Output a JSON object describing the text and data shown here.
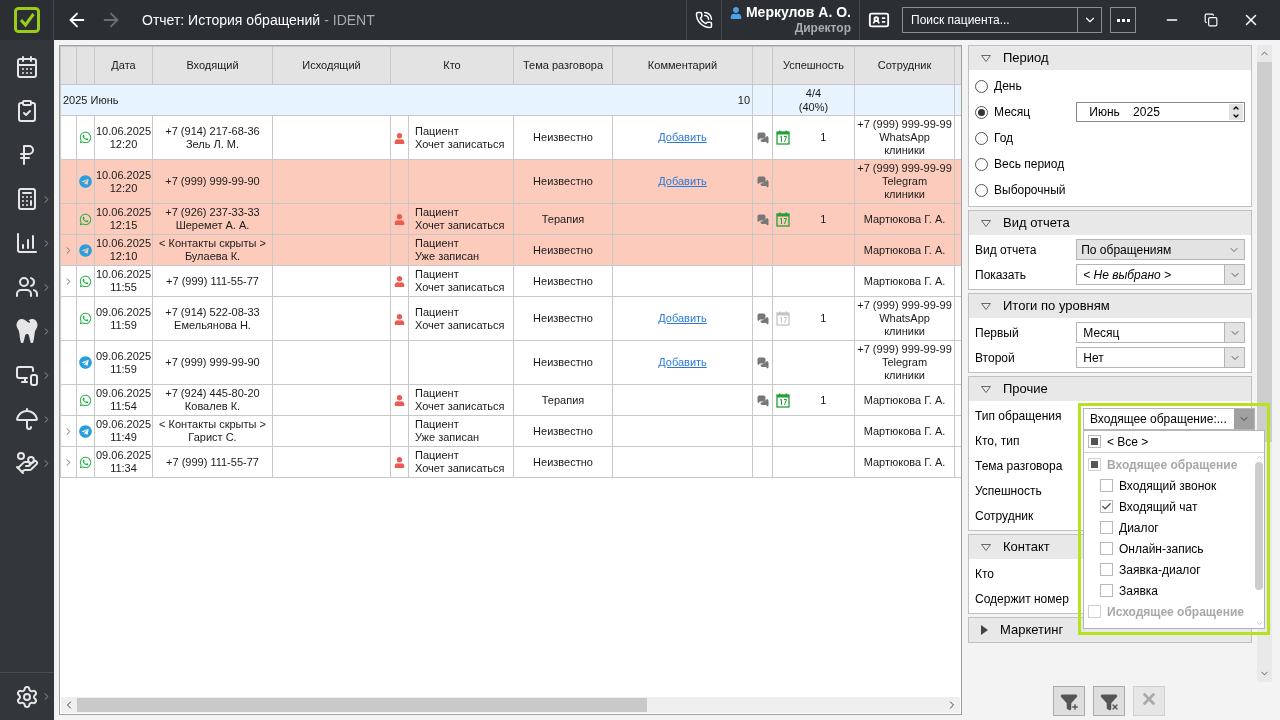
{
  "window": {
    "title": "Отчет: История обращений",
    "app_name": "- IDENT"
  },
  "navigation": {
    "back_enabled": true,
    "forward_enabled": false
  },
  "user": {
    "name": "Меркулов А. О.",
    "role": "Директор"
  },
  "search": {
    "placeholder": "Поиск пациента..."
  },
  "sidebar": {
    "items": [
      {
        "expandable": false
      },
      {
        "expandable": false
      },
      {
        "expandable": false
      },
      {
        "expandable": true
      },
      {
        "expandable": true
      },
      {
        "expandable": true
      },
      {
        "expandable": true
      },
      {
        "expandable": true
      },
      {
        "expandable": true
      },
      {
        "expandable": true
      }
    ],
    "settings": {
      "expandable": true
    }
  },
  "table": {
    "columns": [
      "Дата",
      "Входящий",
      "Исходящий",
      "Кто",
      "Тема разговора",
      "Комментарий",
      "Успешность",
      "Сотрудник"
    ],
    "group": {
      "label": "2025 Июнь",
      "count": "10",
      "success": "4/4",
      "success_percent": "(40%)"
    },
    "rows": [
      {
        "highlighted": false,
        "expandable": false,
        "channel": {
          "kind": "whatsapp"
        },
        "date": "10.06.2025",
        "time": "12:20",
        "incoming": [
          "+7 (914) 217-68-36",
          "Зель Л. М."
        ],
        "who_icon": true,
        "who": [
          "Пациент",
          "Хочет записаться"
        ],
        "topic": "Неизвестно",
        "comment_link": "Добавить",
        "comment_icon": true,
        "calendar": {
          "kind": "active"
        },
        "success_count": "1",
        "employee": [
          "+7 (999) 999-99-99",
          "WhatsApp",
          "клиники"
        ]
      },
      {
        "highlighted": true,
        "expandable": false,
        "channel": {
          "kind": "telegram"
        },
        "date": "10.06.2025",
        "time": "12:20",
        "incoming": [
          "+7 (999) 999-99-90"
        ],
        "who_icon": false,
        "topic": "Неизвестно",
        "comment_link": "Добавить",
        "comment_icon": true,
        "employee": [
          "+7 (999) 999-99-99",
          "Telegram",
          "клиники"
        ]
      },
      {
        "highlighted": true,
        "expandable": false,
        "channel": {
          "kind": "whatsapp"
        },
        "date": "10.06.2025",
        "time": "12:15",
        "incoming": [
          "+7 (926) 237-33-33",
          "Шеремет А. А."
        ],
        "who_icon": true,
        "who": [
          "Пациент",
          "Хочет записаться"
        ],
        "topic": "Терапия",
        "comment_icon": true,
        "calendar": {
          "kind": "active"
        },
        "success_count": "1",
        "employee": [
          "Мартюкова Г. А."
        ]
      },
      {
        "highlighted": true,
        "expandable": true,
        "channel": {
          "kind": "telegram"
        },
        "date": "10.06.2025",
        "time": "12:10",
        "incoming": [
          "< Контакты скрыты >",
          "Булаева К."
        ],
        "who_icon": false,
        "who": [
          "Пациент",
          "Уже записан"
        ],
        "topic": "Неизвестно",
        "comment_icon": false,
        "employee": [
          "Мартюкова Г. А."
        ]
      },
      {
        "highlighted": false,
        "expandable": true,
        "channel": {
          "kind": "whatsapp"
        },
        "date": "10.06.2025",
        "time": "11:55",
        "incoming": [
          "+7 (999) 111-55-77"
        ],
        "who_icon": true,
        "who": [
          "Пациент",
          "Хочет записаться"
        ],
        "topic": "Неизвестно",
        "comment_icon": false,
        "employee": [
          "Мартюкова Г. А."
        ]
      },
      {
        "highlighted": false,
        "expandable": false,
        "channel": {
          "kind": "whatsapp"
        },
        "date": "09.06.2025",
        "time": "11:59",
        "incoming": [
          "+7 (914) 522-08-33",
          "Емельянова Н."
        ],
        "who_icon": true,
        "who": [
          "Пациент",
          "Хочет записаться"
        ],
        "topic": "Неизвестно",
        "comment_link": "Добавить",
        "comment_icon": true,
        "calendar": {
          "kind": "inactive"
        },
        "success_count": "1",
        "employee": [
          "+7 (999) 999-99-99",
          "WhatsApp",
          "клиники"
        ]
      },
      {
        "highlighted": false,
        "expandable": false,
        "channel": {
          "kind": "telegram"
        },
        "date": "09.06.2025",
        "time": "11:59",
        "incoming": [
          "+7 (999) 999-99-90"
        ],
        "who_icon": false,
        "topic": "Неизвестно",
        "comment_link": "Добавить",
        "comment_icon": true,
        "employee": [
          "+7 (999) 999-99-99",
          "Telegram",
          "клиники"
        ]
      },
      {
        "highlighted": false,
        "expandable": false,
        "channel": {
          "kind": "whatsapp"
        },
        "date": "09.06.2025",
        "time": "11:54",
        "incoming": [
          "+7 (924) 445-80-20",
          "Ковалев К."
        ],
        "who_icon": true,
        "who": [
          "Пациент",
          "Хочет записаться"
        ],
        "topic": "Терапия",
        "comment_icon": true,
        "calendar": {
          "kind": "active"
        },
        "success_count": "1",
        "employee": [
          "Мартюкова Г. А."
        ]
      },
      {
        "highlighted": false,
        "expandable": true,
        "channel": {
          "kind": "telegram"
        },
        "date": "09.06.2025",
        "time": "11:49",
        "incoming": [
          "< Контакты скрыты >",
          "Гарист С."
        ],
        "who_icon": false,
        "who": [
          "Пациент",
          "Уже записан"
        ],
        "topic": "Неизвестно",
        "comment_icon": false,
        "employee": [
          "Мартюкова Г. А."
        ]
      },
      {
        "highlighted": false,
        "expandable": true,
        "channel": {
          "kind": "whatsapp"
        },
        "date": "09.06.2025",
        "time": "11:34",
        "incoming": [
          "+7 (999) 111-55-77"
        ],
        "who_icon": true,
        "who": [
          "Пациент",
          "Хочет записаться"
        ],
        "topic": "Неизвестно",
        "comment_icon": false,
        "employee": [
          "Мартюкова Г. А."
        ]
      }
    ]
  },
  "filters": {
    "sections": [
      {
        "kind": "period",
        "title": "Период",
        "expanded": true,
        "options": [
          {
            "label": "День",
            "selected": false
          },
          {
            "label": "Месяц",
            "selected": true,
            "month": "Июнь",
            "year": "2025"
          },
          {
            "label": "Год",
            "selected": false
          },
          {
            "label": "Весь период",
            "selected": false
          },
          {
            "label": "Выборочный",
            "selected": false
          }
        ]
      },
      {
        "kind": "fields",
        "title": "Вид отчета",
        "expanded": true,
        "fields": [
          {
            "label": "Вид отчета",
            "kind": "readonly",
            "value": "По обращениям"
          },
          {
            "label": "Показать",
            "kind": "select",
            "value": "< Не выбрано >",
            "unset": true
          }
        ]
      },
      {
        "kind": "fields",
        "title": "Итоги по уровням",
        "expanded": true,
        "fields": [
          {
            "label": "Первый",
            "kind": "select",
            "value": "Месяц"
          },
          {
            "label": "Второй",
            "kind": "select",
            "value": "Нет"
          }
        ]
      },
      {
        "kind": "fields",
        "title": "Прочие",
        "expanded": true,
        "fields": [
          {
            "label": "Тип обращения",
            "kind": "hidden"
          },
          {
            "label": "Кто, тип",
            "kind": "hidden"
          },
          {
            "label": "Тема разговора",
            "kind": "hidden"
          },
          {
            "label": "Успешность",
            "kind": "hidden"
          },
          {
            "label": "Сотрудник",
            "kind": "hidden"
          }
        ]
      },
      {
        "kind": "fields",
        "title": "Контакт",
        "expanded": true,
        "fields": [
          {
            "label": "Кто",
            "kind": "hidden"
          },
          {
            "label": "Содержит номер",
            "kind": "hidden"
          }
        ]
      },
      {
        "title": "Маркетинг",
        "expanded": false
      }
    ],
    "dropdown": {
      "value": "Входящее обращение:...",
      "items": [
        {
          "kind": "all",
          "label": "< Все >",
          "indeterminate": true
        },
        {
          "kind": "group",
          "label": "Входящее обращение",
          "indeterminate": true,
          "children": [
            {
              "label": "Входящий звонок",
              "checked": false
            },
            {
              "label": "Входящий чат",
              "checked": true
            },
            {
              "label": "Диалог",
              "checked": false
            },
            {
              "label": "Онлайн-запись",
              "checked": false
            },
            {
              "label": "Заявка-диалог",
              "checked": false
            },
            {
              "label": "Заявка",
              "checked": false
            }
          ]
        },
        {
          "kind": "group",
          "label": "Исходящее обращение",
          "indeterminate": false
        }
      ]
    },
    "actions": [
      {
        "kind": "add_filter",
        "disabled": false
      },
      {
        "kind": "remove_filter",
        "disabled": false
      },
      {
        "kind": "reset",
        "disabled": true
      }
    ]
  }
}
